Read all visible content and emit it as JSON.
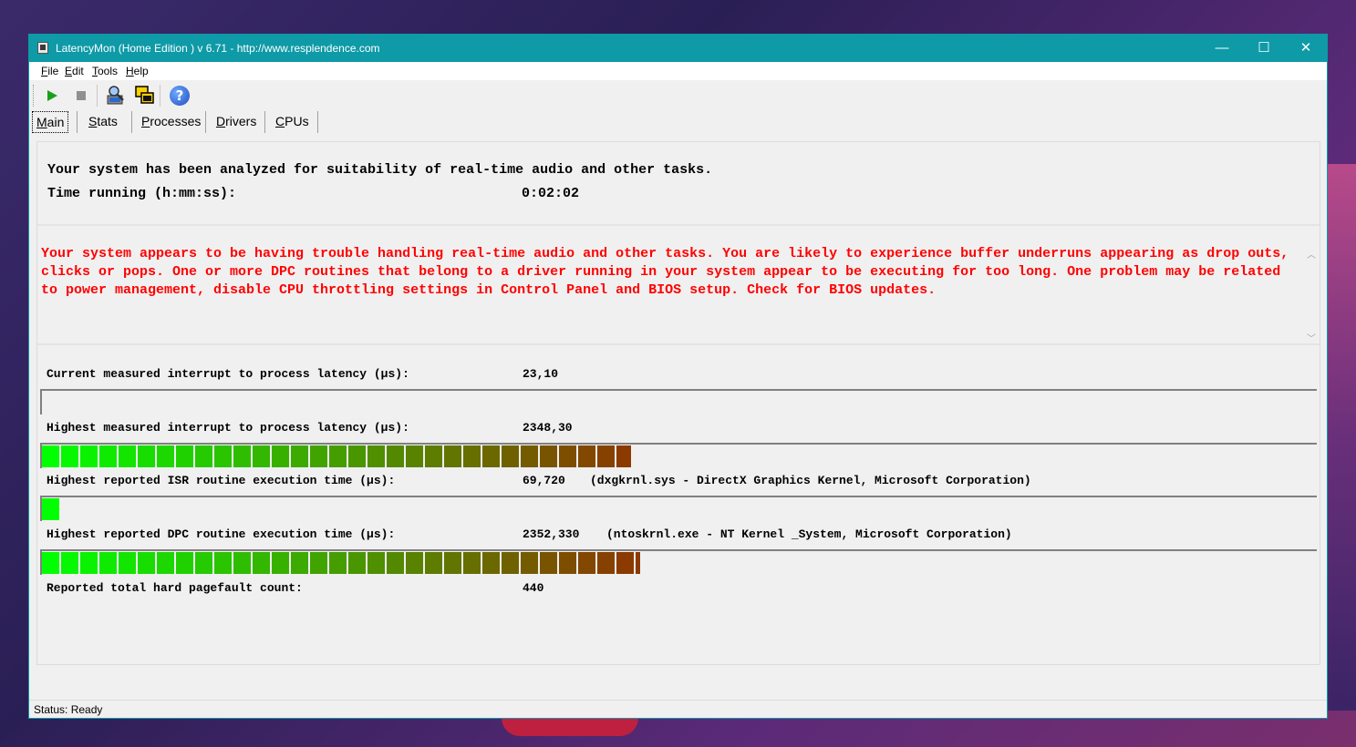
{
  "window": {
    "title": "LatencyMon  (Home Edition )  v 6.71 - http://www.resplendence.com",
    "minimize_glyph": "—",
    "maximize_glyph": "☐",
    "close_glyph": "✕"
  },
  "menu": [
    "File",
    "Edit",
    "Tools",
    "Help"
  ],
  "toolbar": {
    "icons": [
      "play-icon",
      "stop-icon",
      "analyze-icon",
      "windows-icon",
      "help-icon"
    ],
    "help_glyph": "?"
  },
  "tabs": [
    "Main",
    "Stats",
    "Processes",
    "Drivers",
    "CPUs"
  ],
  "summary": {
    "line1": "Your system has been analyzed for suitability of real-time audio and other tasks.",
    "time_label": "Time running (h:mm:ss):",
    "time_value": "0:02:02"
  },
  "warning": "Your system appears to be having trouble handling real-time audio and other tasks. You are likely to experience buffer underruns appearing as drop outs, clicks or pops. One or more DPC routines that belong to a driver running in your system appear to be executing for too long. One problem may be related to power management, disable CPU throttling settings in Control Panel and BIOS setup. Check for BIOS updates.",
  "metrics": [
    {
      "label": "Current measured interrupt to process latency (µs):",
      "value": "23,10",
      "detail": "",
      "bar_fraction": 0.0
    },
    {
      "label": "Highest measured interrupt to process latency (µs):",
      "value": "2348,30",
      "detail": "",
      "bar_fraction": 0.463
    },
    {
      "label": "Highest reported ISR routine execution time (µs):",
      "value": "69,720",
      "detail": "(dxgkrnl.sys - DirectX Graphics Kernel, Microsoft Corporation)",
      "bar_fraction": 0.015
    },
    {
      "label": "Highest reported DPC routine execution time (µs):",
      "value": "2352,330",
      "detail": "(ntoskrnl.exe - NT Kernel _System, Microsoft Corporation)",
      "bar_fraction": 0.47
    },
    {
      "label": "Reported total hard pagefault count:",
      "value": "440",
      "detail": ""
    }
  ],
  "status": "Status: Ready",
  "colors": {
    "titlebar": "#0e9aa7",
    "warning": "#ff0000",
    "bar_start": "#00ff00",
    "bar_end": "#8b3a00"
  }
}
